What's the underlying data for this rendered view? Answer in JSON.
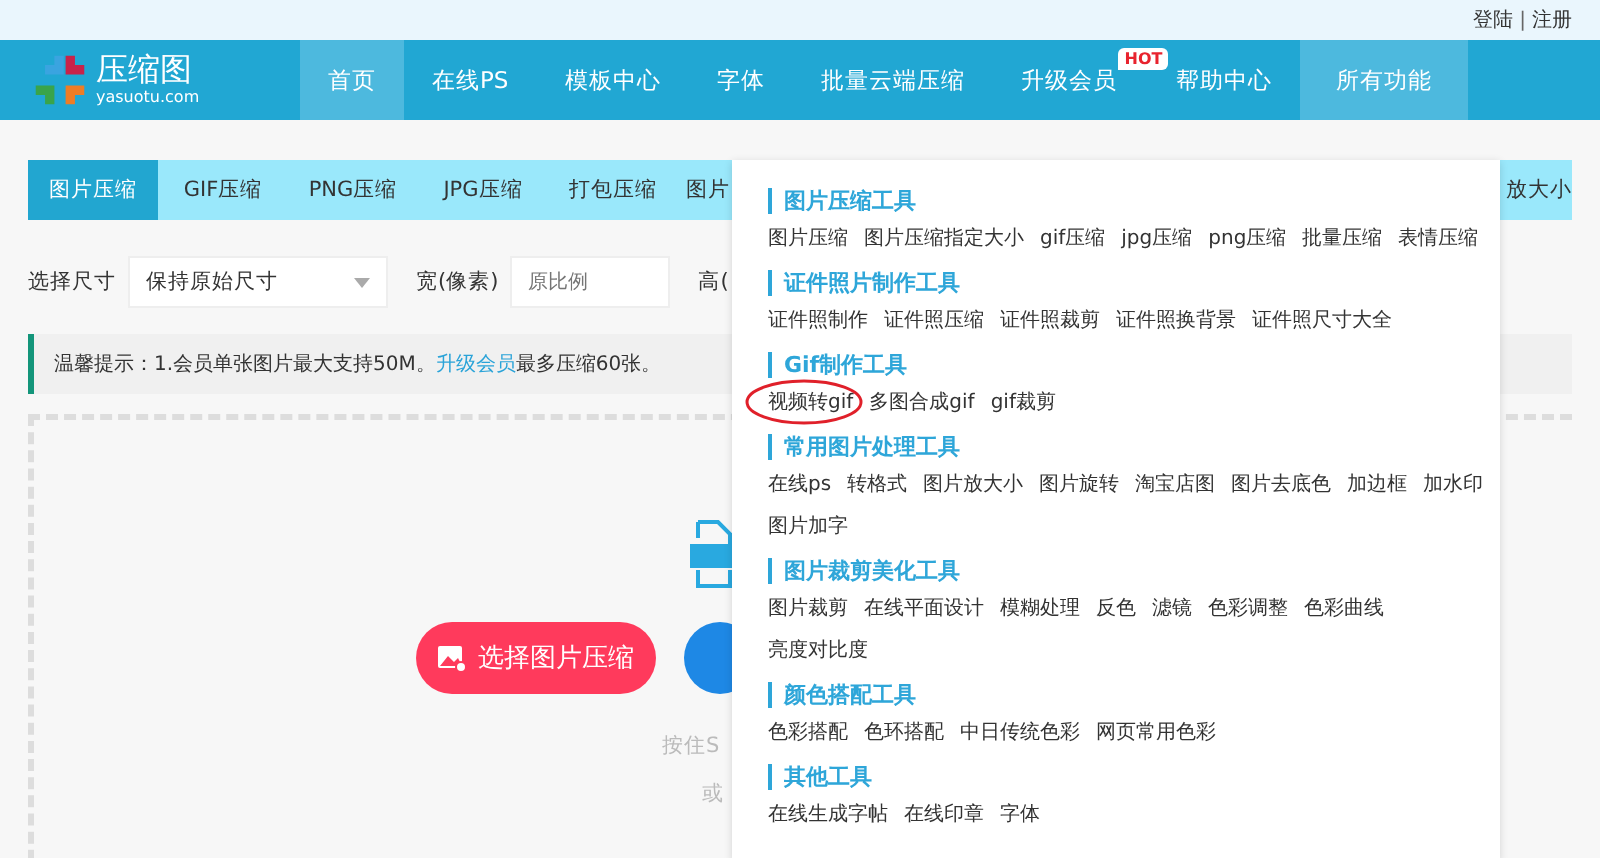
{
  "top_links": [
    "登陆",
    "注册"
  ],
  "top_links_separator": "|",
  "logo": {
    "name": "压缩图",
    "domain": "yasuotu.com"
  },
  "nav": [
    {
      "label": "首页",
      "selected": true
    },
    {
      "label": "在线PS",
      "selected": false
    },
    {
      "label": "模板中心",
      "selected": false
    },
    {
      "label": "字体",
      "selected": false
    },
    {
      "label": "批量云端压缩",
      "selected": false
    },
    {
      "label": "升级会员",
      "selected": false,
      "badge": "HOT"
    },
    {
      "label": "帮助中心",
      "selected": false
    },
    {
      "label": "所有功能",
      "selected": true
    }
  ],
  "tabs": [
    {
      "label": "图片压缩",
      "selected": true
    },
    {
      "label": "GIF压缩",
      "selected": false
    },
    {
      "label": "PNG压缩",
      "selected": false
    },
    {
      "label": "JPG压缩",
      "selected": false
    },
    {
      "label": "打包压缩",
      "selected": false
    },
    {
      "label": "图片",
      "selected": false
    }
  ],
  "tab_tail": "放大小",
  "size_form": {
    "size_label": "选择尺寸",
    "size_value": "保持原始尺寸",
    "width_label": "宽(像素)",
    "width_placeholder": "原比例",
    "height_label": "高("
  },
  "notice": {
    "text": "温馨提示：1.会员单张图片最大支持50M。",
    "link": "升级会员",
    "after": "最多压缩60张。"
  },
  "upload": {
    "button": "选择图片压缩",
    "hint": "按住S",
    "hint2": "或"
  },
  "menu": [
    {
      "title": "图片压缩工具",
      "items": [
        {
          "label": "图片压缩"
        },
        {
          "label": "图片压缩指定大小"
        },
        {
          "label": "gif压缩"
        },
        {
          "label": "jpg压缩"
        },
        {
          "label": "png压缩"
        },
        {
          "label": "批量压缩"
        },
        {
          "label": "表情压缩"
        }
      ]
    },
    {
      "title": "证件照片制作工具",
      "items": [
        {
          "label": "证件照制作"
        },
        {
          "label": "证件照压缩"
        },
        {
          "label": "证件照裁剪"
        },
        {
          "label": "证件照换背景"
        },
        {
          "label": "证件照尺寸大全"
        }
      ]
    },
    {
      "title": "Gif制作工具",
      "items": [
        {
          "label": "视频转gif",
          "circled": true
        },
        {
          "label": "多图合成gif"
        },
        {
          "label": "gif裁剪"
        }
      ]
    },
    {
      "title": "常用图片处理工具",
      "items": [
        {
          "label": "在线ps"
        },
        {
          "label": "转格式"
        },
        {
          "label": "图片放大小"
        },
        {
          "label": "图片旋转"
        },
        {
          "label": "淘宝店图"
        },
        {
          "label": "图片去底色"
        },
        {
          "label": "加边框"
        },
        {
          "label": "加水印"
        },
        {
          "label": "图片加字"
        }
      ]
    },
    {
      "title": "图片裁剪美化工具",
      "items": [
        {
          "label": "图片裁剪"
        },
        {
          "label": "在线平面设计"
        },
        {
          "label": "模糊处理"
        },
        {
          "label": "反色"
        },
        {
          "label": "滤镜"
        },
        {
          "label": "色彩调整"
        },
        {
          "label": "色彩曲线"
        },
        {
          "label": "亮度对比度"
        }
      ]
    },
    {
      "title": "颜色搭配工具",
      "items": [
        {
          "label": "色彩搭配"
        },
        {
          "label": "色环搭配"
        },
        {
          "label": "中日传统色彩"
        },
        {
          "label": "网页常用色彩"
        }
      ]
    },
    {
      "title": "其他工具",
      "items": [
        {
          "label": "在线生成字帖"
        },
        {
          "label": "在线印章"
        },
        {
          "label": "字体"
        }
      ]
    }
  ]
}
